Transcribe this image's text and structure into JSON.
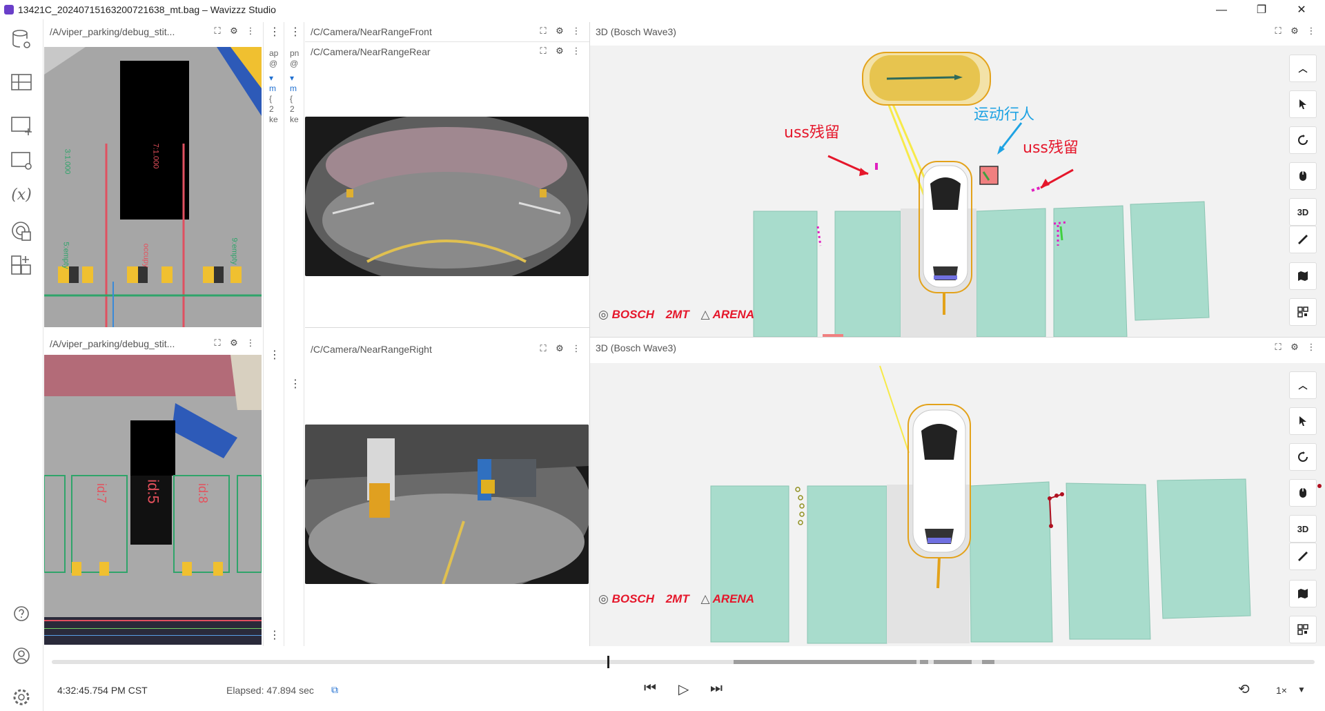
{
  "window": {
    "title": "13421C_20240715163200721638_mt.bag – Wavizzz Studio",
    "minimize": "—",
    "restore": "❐",
    "close": "✕"
  },
  "sidebar": {
    "icons": [
      "data-source-settings-icon",
      "layout-icon",
      "add-panel-icon",
      "panel-settings-icon",
      "variables-icon",
      "extensions-icon",
      "add-layout-icon",
      "help-icon",
      "account-icon",
      "settings-icon"
    ],
    "variables_glyph": "(x)"
  },
  "panels": {
    "stitch_top": {
      "title": "/A/viper_parking/debug_stit..."
    },
    "stitch_bottom": {
      "title": "/A/viper_parking/debug_stit..."
    },
    "cam_front": {
      "title": "/C/Camera/NearRangeFront"
    },
    "cam_rear": {
      "title": "/C/Camera/NearRangeRear"
    },
    "cam_right": {
      "title": "/C/Camera/NearRangeRight"
    },
    "scene_top": {
      "title": "3D (Bosch Wave3)"
    },
    "scene_bottom": {
      "title": "3D (Bosch Wave3)"
    },
    "narrow_a": {
      "lines": [
        "ap",
        "@",
        "▾",
        "m",
        "{",
        "2",
        "ke"
      ]
    },
    "narrow_b": {
      "lines": [
        "pn",
        "@",
        "▾",
        "m",
        "{",
        "2",
        "ke"
      ]
    }
  },
  "stitch_labels": {
    "top": [
      "7:1.000",
      "3:1.000",
      "5:empty",
      "occupy",
      "9:empty"
    ],
    "bottom": [
      "id:5",
      "id:7",
      "id:8"
    ]
  },
  "annotations": {
    "uss_left": "uss残留",
    "pedestrian": "运动行人",
    "uss_right": "uss残留"
  },
  "logos": {
    "bosch": "BOSCH",
    "brand2": "2MT",
    "arena": "ARENA"
  },
  "toolbar_3d": {
    "view3d": "3D"
  },
  "playback": {
    "time": "4:32:45.754 PM CST",
    "elapsed": "Elapsed: 47.894 sec",
    "speed": "1×",
    "progress": 0.44
  },
  "colors": {
    "accent_red": "#e5172b",
    "accent_blue": "#1fa3e3",
    "slot_green": "#a8dccc",
    "ego_box": "#e3a21a"
  }
}
